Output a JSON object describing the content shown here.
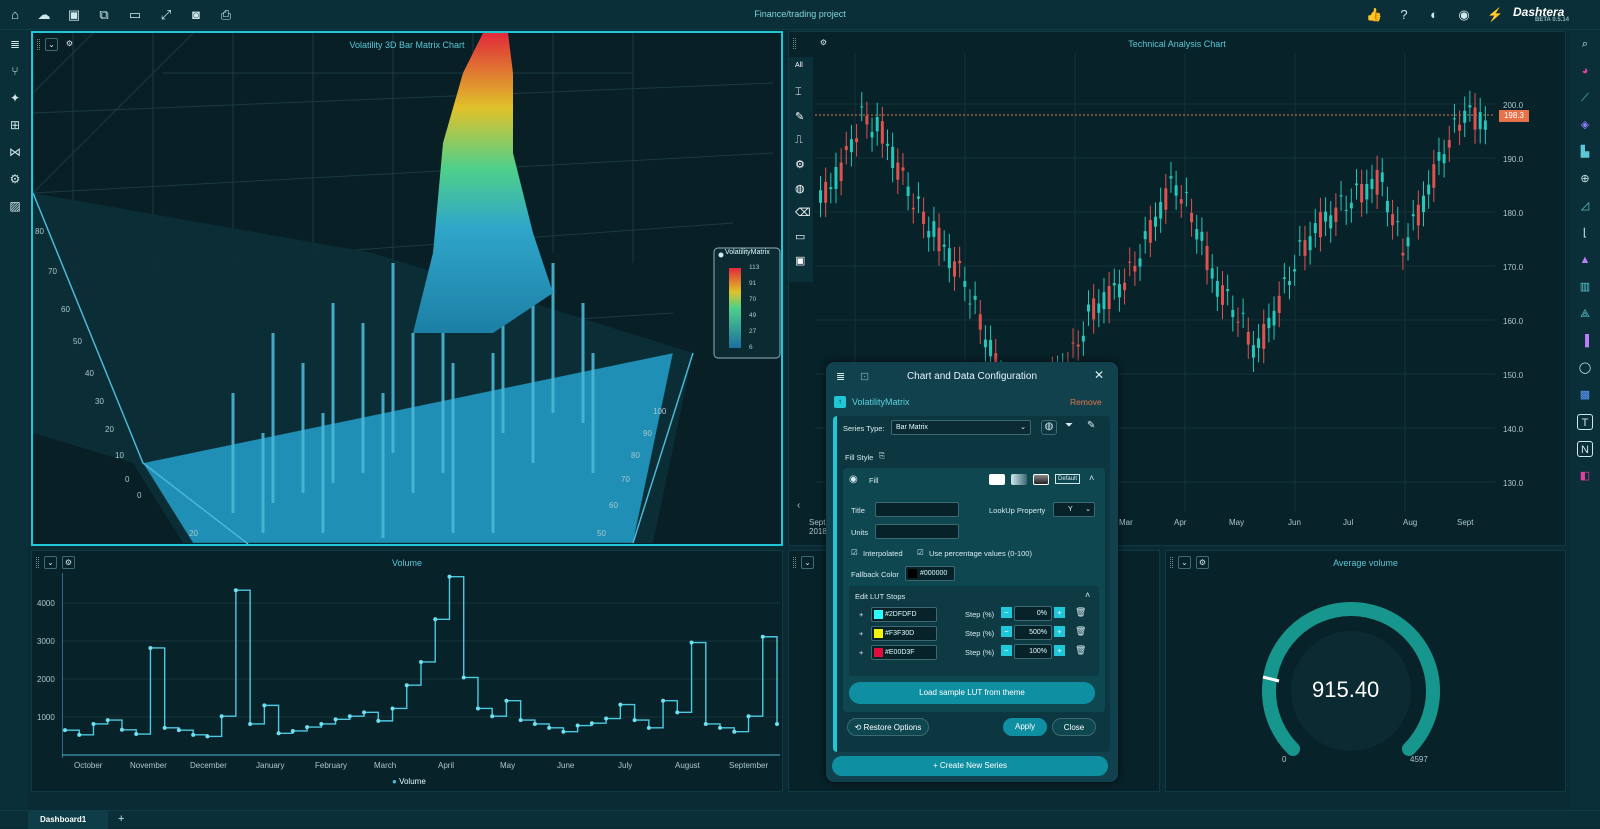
{
  "app": {
    "project_title": "Finance/trading project",
    "logo": "Dashtera",
    "logo_sub": "BETA 0.5.14"
  },
  "toolbar": [
    "home-icon",
    "cloud-sync-icon",
    "save-icon",
    "save-all-icon",
    "folder-icon",
    "fullscreen-icon",
    "camera-icon",
    "export-icon"
  ],
  "panels": {
    "bar3d": {
      "title": "Volatility 3D Bar Matrix Chart",
      "y_ticks": [
        "80",
        "70",
        "60",
        "50",
        "40",
        "30",
        "20",
        "10",
        "0"
      ],
      "z_ticks": [
        "100",
        "90",
        "80",
        "70",
        "60",
        "50"
      ],
      "x_ticks": [
        "0",
        "20"
      ],
      "legend_title": "VolatilityMatrix",
      "legend_ticks": [
        "113",
        "91",
        "70",
        "49",
        "27",
        "6"
      ]
    },
    "technical": {
      "title": "Technical Analysis Chart",
      "price_marker": "198.3",
      "y_ticks": [
        "200.0",
        "190.0",
        "180.0",
        "170.0",
        "160.0",
        "150.0",
        "140.0",
        "130.0"
      ],
      "x_ticks": [
        "Sept",
        "Mar",
        "Apr",
        "May",
        "Jun",
        "Jul",
        "Aug",
        "Sept"
      ],
      "x_sub": "2018",
      "side_tools": [
        "All"
      ]
    },
    "volume": {
      "title": "Volume",
      "y_ticks": [
        "4000",
        "3000",
        "2000",
        "1000"
      ],
      "x_ticks": [
        "October",
        "November",
        "December",
        "January",
        "February",
        "March",
        "April",
        "May",
        "June",
        "July",
        "August",
        "September"
      ],
      "legend": "Volume"
    },
    "gauge": {
      "title": "Average volume",
      "value": "915.40",
      "min": "0",
      "max": "4597"
    }
  },
  "dialog": {
    "title": "Chart and Data Configuration",
    "series_name": "VolatilityMatrix",
    "remove": "Remove",
    "series_type_label": "Series Type:",
    "series_type_value": "Bar Matrix",
    "fill_style_label": "Fill Style",
    "fill_label": "Fill",
    "default_label": "Default",
    "title_label": "Title",
    "units_label": "Units",
    "lookup_label": "LookUp Property",
    "lookup_value": "Y",
    "interpolated": "Interpolated",
    "use_percentage": "Use percentage values (0-100)",
    "fallback_label": "Fallback Color",
    "fallback_value": "#000000",
    "lut_title": "Edit LUT Stops",
    "stops": [
      {
        "color": "#2DFDFD",
        "step": "0%"
      },
      {
        "color": "#F3F30D",
        "step": "500%"
      },
      {
        "color": "#E00D3F",
        "step": "100%"
      }
    ],
    "step_label": "Step (%)",
    "load_lut": "Load sample LUT from theme",
    "restore": "Restore Options",
    "apply": "Apply",
    "close": "Close",
    "create": "Create New Series"
  },
  "tabs": {
    "active": "Dashboard1",
    "add": "+"
  },
  "chart_data": [
    {
      "type": "line",
      "title": "Volume",
      "series": [
        {
          "name": "Volume",
          "values": [
            640,
            520,
            800,
            900,
            650,
            540,
            2760,
            700,
            640,
            520,
            480,
            1000,
            4250,
            800,
            1280,
            560,
            620,
            720,
            800,
            920,
            1000,
            1100,
            880,
            1200,
            1800,
            2400,
            3500,
            4600,
            2000,
            1200,
            1000,
            1400,
            900,
            800,
            700,
            600,
            760,
            820,
            940,
            1300,
            900,
            700,
            1400,
            1100,
            2900,
            800,
            700,
            600,
            1000,
            3050,
            800
          ]
        }
      ],
      "ylim": [
        0,
        4600
      ],
      "categories": [
        "October",
        "November",
        "December",
        "January",
        "February",
        "March",
        "April",
        "May",
        "June",
        "July",
        "August",
        "September"
      ]
    },
    {
      "type": "line",
      "title": "Technical Analysis Chart",
      "ylim": [
        130,
        210
      ],
      "series": [
        {
          "name": "price",
          "values": [
            184,
            190,
            199,
            196,
            188,
            181,
            176,
            170,
            160,
            150,
            148,
            152,
            156,
            165,
            168,
            172,
            180,
            188,
            181,
            170,
            165,
            158,
            166,
            175,
            180,
            183,
            186,
            188,
            176,
            184,
            193,
            200,
            198
          ]
        }
      ]
    }
  ]
}
